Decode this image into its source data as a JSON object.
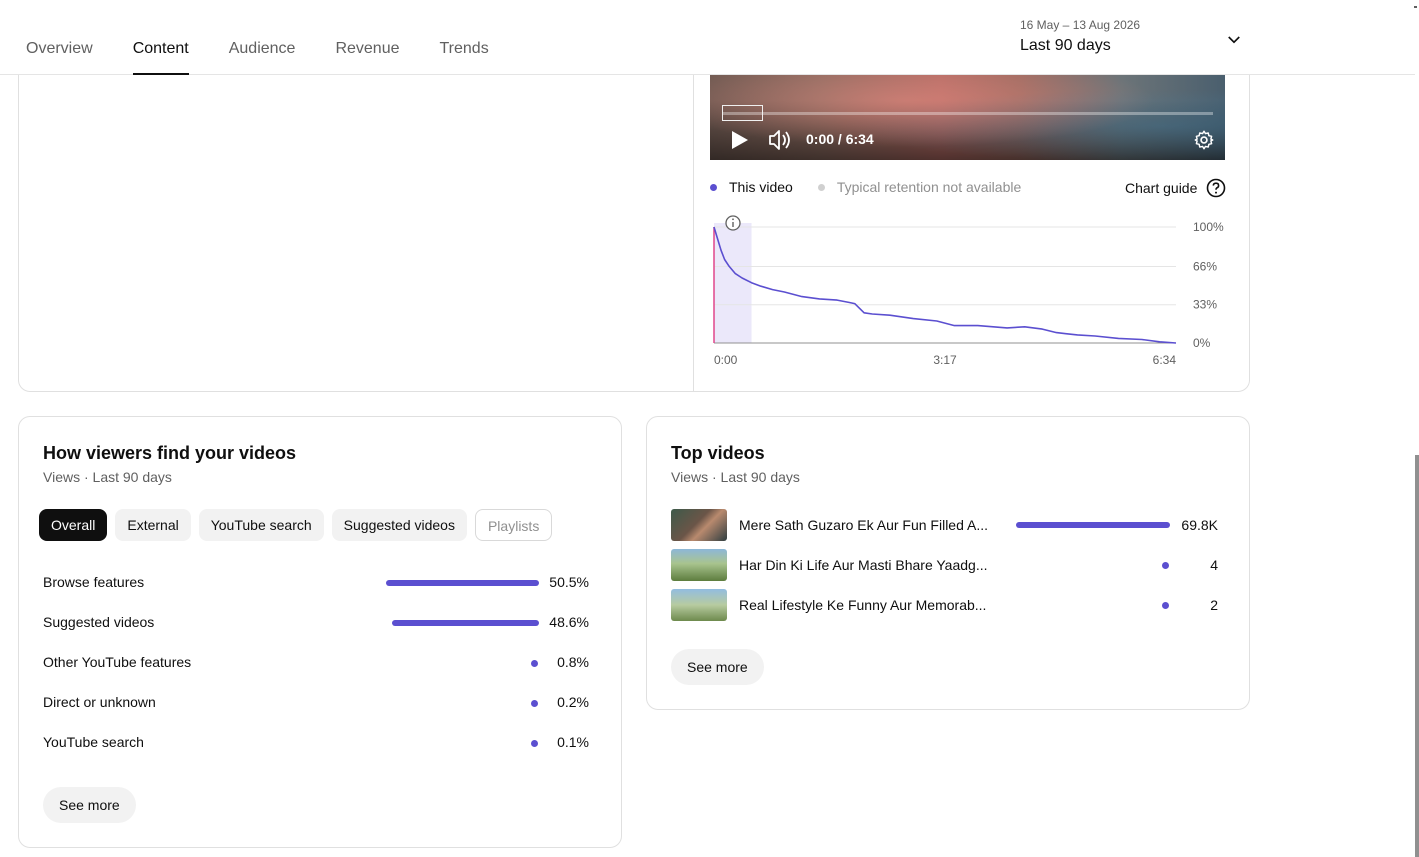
{
  "header": {
    "tabs": [
      {
        "label": "Overview"
      },
      {
        "label": "Content"
      },
      {
        "label": "Audience"
      },
      {
        "label": "Revenue"
      },
      {
        "label": "Trends"
      }
    ],
    "active_tab": "Content",
    "date_range": "16 May – 13 Aug 2026",
    "date_label": "Last 90 days"
  },
  "player": {
    "time": "0:00 / 6:34",
    "progress": 0
  },
  "retention": {
    "legend_this": "This video",
    "legend_typical": "Typical retention not available",
    "chart_guide": "Chart guide",
    "colors": {
      "this_video": "#5b4fd0",
      "typical": "#d0d0d0",
      "playhead": "#e0458a"
    }
  },
  "chart_data": {
    "type": "line",
    "x_ticks": [
      "0:00",
      "3:17",
      "6:34"
    ],
    "y_ticks": [
      "100%",
      "66%",
      "33%",
      "0%"
    ],
    "xlim": [
      0,
      394
    ],
    "ylim": [
      0,
      100
    ],
    "series": [
      {
        "name": "This video",
        "x": [
          0,
          3,
          6,
          9,
          13,
          18,
          24,
          32,
          40,
          50,
          60,
          75,
          90,
          105,
          115,
          120,
          124,
          128,
          135,
          150,
          170,
          190,
          205,
          225,
          250,
          265,
          280,
          292,
          300,
          310,
          325,
          345,
          365,
          380,
          394
        ],
        "y": [
          100,
          90,
          80,
          72,
          66,
          60,
          56,
          52,
          49,
          46,
          44,
          40,
          38,
          37,
          35,
          34,
          30,
          26,
          25,
          24,
          21,
          19,
          15,
          15,
          13,
          14,
          12,
          9,
          8,
          7,
          6,
          4,
          3,
          1,
          0
        ]
      }
    ],
    "highlight_range": [
      0,
      32
    ],
    "grid": true
  },
  "traffic": {
    "title": "How viewers find your videos",
    "subtitle": "Views · Last 90 days",
    "chips": [
      "Overall",
      "External",
      "YouTube search",
      "Suggested videos",
      "Playlists"
    ],
    "rows": [
      {
        "label": "Browse features",
        "value": "50.5%",
        "pct": 50.5
      },
      {
        "label": "Suggested videos",
        "value": "48.6%",
        "pct": 48.6
      },
      {
        "label": "Other YouTube features",
        "value": "0.8%",
        "pct": 0.8
      },
      {
        "label": "Direct or unknown",
        "value": "0.2%",
        "pct": 0.2
      },
      {
        "label": "YouTube search",
        "value": "0.1%",
        "pct": 0.1
      }
    ],
    "see_more": "See more"
  },
  "top_videos": {
    "title": "Top videos",
    "subtitle": "Views · Last 90 days",
    "rows": [
      {
        "title": "Mere Sath Guzaro Ek Aur Fun Filled A...",
        "value": "69.8K",
        "views": 69800
      },
      {
        "title": "Har Din Ki Life Aur Masti Bhare Yaadg...",
        "value": "4",
        "views": 4
      },
      {
        "title": "Real Lifestyle Ke Funny Aur Memorab...",
        "value": "2",
        "views": 2
      }
    ],
    "see_more": "See more"
  }
}
